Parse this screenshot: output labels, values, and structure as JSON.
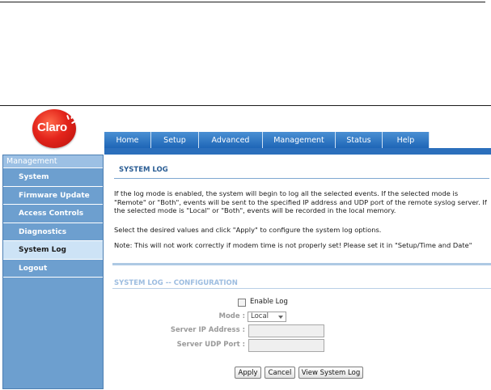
{
  "brand": {
    "logo_text": "Claro",
    "accent": "#e3241b"
  },
  "nav": {
    "tabs": [
      "Home",
      "Setup",
      "Advanced",
      "Management",
      "Status",
      "Help"
    ],
    "active_tab": "Management",
    "tab_color": "#2b6fbc"
  },
  "sidebar": {
    "header": "Management",
    "items": [
      "System",
      "Firmware Update",
      "Access Controls",
      "Diagnostics",
      "System Log",
      "Logout"
    ],
    "active_item": "System Log"
  },
  "main": {
    "section_title": "SYSTEM LOG",
    "description": "If the log mode is enabled, the system will begin to log all the selected events. If the selected mode is \"Remote\" or \"Both\", events will be sent to the specified IP address and UDP port of the remote syslog server. If the selected mode is \"Local\" or \"Both\", events will be recorded in the local memory.",
    "instruction": "Select the desired values and click \"Apply\" to configure the system log options.",
    "note": "Note: This will not work correctly if modem time is not properly set! Please set it in \"Setup/Time and Date\"",
    "config_title": "SYSTEM LOG -- CONFIGURATION",
    "enable_log_label": "Enable Log",
    "enable_log_checked": false,
    "mode_label": "Mode :",
    "mode_value": "Local",
    "server_ip_label": "Server IP Address :",
    "server_ip_value": "",
    "server_port_label": "Server UDP Port :",
    "server_port_value": ""
  },
  "buttons": {
    "apply": "Apply",
    "cancel": "Cancel",
    "view": "View System Log"
  }
}
